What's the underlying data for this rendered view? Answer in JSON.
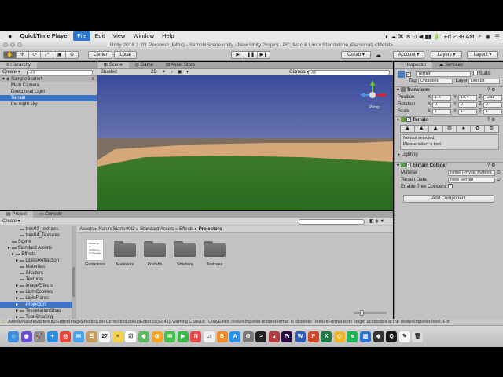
{
  "menubar": {
    "apple": "",
    "items": [
      "QuickTime Player",
      "File",
      "Edit",
      "View",
      "Window",
      "Help"
    ],
    "clock": "Fri 2:38 AM"
  },
  "window_title": "Unity 2018.2.1f1 Personal (64bit) - SampleScene.unity - New Unity Project - PC, Mac & Linux Standalone (Personal) <Metal>",
  "toolbar": {
    "pivot": "Center",
    "space": "Local",
    "collab": "Collab ▾",
    "account": "Account ▾",
    "layers": "Layers ▾",
    "layout": "Layout ▾"
  },
  "hierarchy": {
    "tab": "Hierarchy",
    "create": "Create ▾",
    "search_placeholder": "All",
    "scene": "SampleScene*",
    "items": [
      "Main Camera",
      "Directional Light",
      "Terrain",
      "the night sky"
    ],
    "selected_item": "Terrain"
  },
  "scene_view": {
    "tabs": [
      "Scene",
      "Game",
      "Asset Store"
    ],
    "active_tab": "Scene",
    "shading": "Shaded",
    "mode_2d": "2D",
    "gizmos": "Gizmos ▾",
    "search_placeholder": "All",
    "gizmo_label": "Persp"
  },
  "inspector": {
    "tabs": [
      "Inspector",
      "Services"
    ],
    "object_name": "Terrain",
    "static_label": "Static",
    "tag_label": "Tag",
    "tag_value": "Untagged",
    "layer_label": "Layer",
    "layer_value": "Default",
    "transform": {
      "title": "Transform",
      "position_label": "Position",
      "rotation_label": "Rotation",
      "scale_label": "Scale",
      "position": {
        "x": "1.8",
        "y": "19.4",
        "z": "-281"
      },
      "rotation": {
        "x": "0",
        "y": "0",
        "z": "0"
      },
      "scale": {
        "x": "1",
        "y": "1",
        "z": "1"
      }
    },
    "terrain": {
      "title": "Terrain",
      "status": "No tool selected",
      "hint": "Please select a tool",
      "lighting": "Lighting"
    },
    "terrain_collider": {
      "title": "Terrain Collider",
      "material_label": "Material",
      "material_value": "None (Physic Materia",
      "data_label": "Terrain Data",
      "data_value": "New Terrain",
      "trees_label": "Enable Tree Colliders"
    },
    "add_component": "Add Component"
  },
  "project": {
    "tabs": [
      "Project",
      "Console"
    ],
    "create": "Create ▾",
    "tree": [
      {
        "label": "tree03_textures",
        "indent": 5
      },
      {
        "label": "tree04_Textures",
        "indent": 5
      },
      {
        "label": "Scene",
        "indent": 3
      },
      {
        "label": "Standard Assets",
        "indent": 2
      },
      {
        "label": "Effects",
        "indent": 3
      },
      {
        "label": "GlassRefraction",
        "indent": 4
      },
      {
        "label": "Materials",
        "indent": 5
      },
      {
        "label": "Shaders",
        "indent": 5
      },
      {
        "label": "Textures",
        "indent": 5
      },
      {
        "label": "ImageEffects",
        "indent": 4
      },
      {
        "label": "LightCookies",
        "indent": 4
      },
      {
        "label": "LightFlares",
        "indent": 4
      },
      {
        "label": "Projectors",
        "indent": 4
      },
      {
        "label": "TessellationShad",
        "indent": 4
      },
      {
        "label": "ToonShading",
        "indent": 4
      }
    ],
    "selected_tree": "Projectors",
    "breadcrumb": [
      "Assets",
      "NatureStarterKit2",
      "Standard Assets",
      "Effects",
      "Projectors"
    ],
    "files": [
      {
        "label": "Guidelines",
        "kind": "doc"
      },
      {
        "label": "Materials",
        "kind": "folder"
      },
      {
        "label": "Prefabs",
        "kind": "folder"
      },
      {
        "label": "Shaders",
        "kind": "folder"
      },
      {
        "label": "Textures",
        "kind": "folder"
      }
    ],
    "doc_preview": "Please go to guidelines on the web"
  },
  "console_line": "Assets/NatureStarterKit2/Editor/ImageEffects/ColorCorrectionLookupEditor.cs(62,41): warning CS0618: `UnityEditor.TextureImporter.textureFormat' is obsolete: `textureFormat is no longer accessible at the TextureImporter level. For",
  "dock": {
    "icons": [
      {
        "name": "finder-icon",
        "color": "#3d8fe0",
        "glyph": "☺"
      },
      {
        "name": "siri-icon",
        "color": "#6a4fd0",
        "glyph": "◉"
      },
      {
        "name": "launchpad-icon",
        "color": "#8e8e8e",
        "glyph": "🚀"
      },
      {
        "name": "safari-icon",
        "color": "#2a8de0",
        "glyph": "✦"
      },
      {
        "name": "chrome-icon",
        "color": "#e8453c",
        "glyph": "◎"
      },
      {
        "name": "mail-icon",
        "color": "#4aa3f0",
        "glyph": "✉"
      },
      {
        "name": "contacts-icon",
        "color": "#c89a5a",
        "glyph": "☰"
      },
      {
        "name": "calendar-icon",
        "color": "#f5f5f5",
        "glyph": "27"
      },
      {
        "name": "notes-icon",
        "color": "#f2d34b",
        "glyph": "≡"
      },
      {
        "name": "reminders-icon",
        "color": "#ffffff",
        "glyph": "☑"
      },
      {
        "name": "maps-icon",
        "color": "#5fb85f",
        "glyph": "◆"
      },
      {
        "name": "photos-icon",
        "color": "#f5a623",
        "glyph": "✿"
      },
      {
        "name": "messages-icon",
        "color": "#45c14b",
        "glyph": "✉"
      },
      {
        "name": "facetime-icon",
        "color": "#3cb84a",
        "glyph": "▶"
      },
      {
        "name": "news-icon",
        "color": "#e84a4a",
        "glyph": "N"
      },
      {
        "name": "music-icon",
        "color": "#f0f0f0",
        "glyph": "♫"
      },
      {
        "name": "books-icon",
        "color": "#f08a24",
        "glyph": "B"
      },
      {
        "name": "appstore-icon",
        "color": "#2c8ff0",
        "glyph": "A"
      },
      {
        "name": "preferences-icon",
        "color": "#7a7a7a",
        "glyph": "⚙"
      },
      {
        "name": "terminal-icon",
        "color": "#222222",
        "glyph": ">"
      },
      {
        "name": "unity-hub-icon",
        "color": "#b23a3a",
        "glyph": "▲"
      },
      {
        "name": "premiere-icon",
        "color": "#2a0a45",
        "glyph": "Pr"
      },
      {
        "name": "word-icon",
        "color": "#2b5eb4",
        "glyph": "W"
      },
      {
        "name": "powerpoint-icon",
        "color": "#d04525",
        "glyph": "P"
      },
      {
        "name": "excel-icon",
        "color": "#1f7a44",
        "glyph": "X"
      },
      {
        "name": "vectorize-icon",
        "color": "#f0b428",
        "glyph": "◇"
      },
      {
        "name": "spotify-icon",
        "color": "#1db954",
        "glyph": "≋"
      },
      {
        "name": "bars-icon",
        "color": "#2f6fd0",
        "glyph": "▥"
      },
      {
        "name": "unity-icon",
        "color": "#333333",
        "glyph": "◈"
      },
      {
        "name": "quicktime-icon",
        "color": "#1a1a1a",
        "glyph": "Q"
      },
      {
        "name": "textedit-icon",
        "color": "#f5f5f5",
        "glyph": "✎"
      },
      {
        "name": "trash-icon",
        "color": "#dcdcdc",
        "glyph": "🗑"
      }
    ]
  }
}
